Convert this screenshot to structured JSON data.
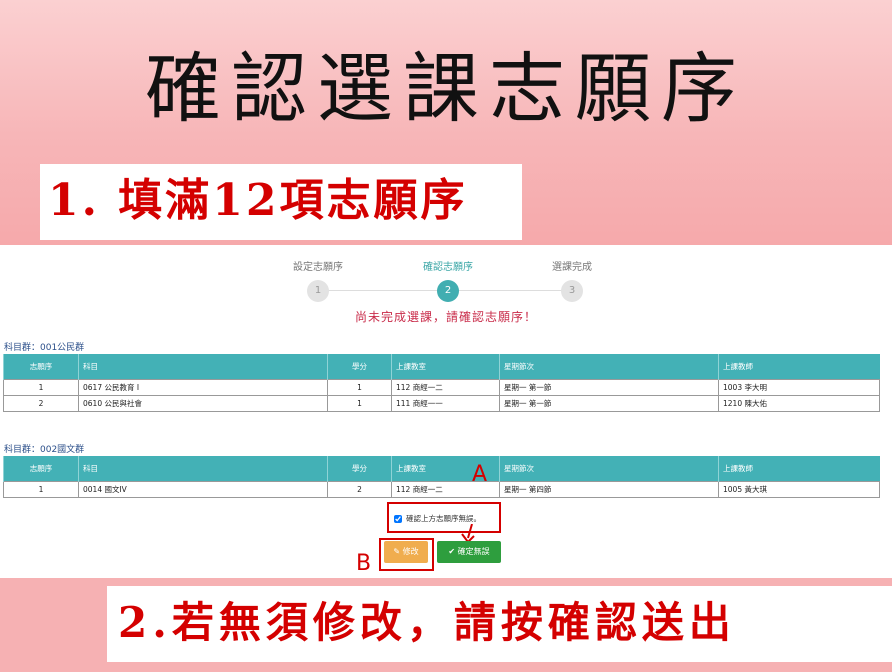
{
  "title": "確認選課志願序",
  "step1_instruction": "1. 填滿12項志願序",
  "step2_instruction": "2.若無須修改，請按確認送出",
  "stepper": {
    "steps": [
      {
        "label": "設定志願序",
        "number": "1",
        "active": false
      },
      {
        "label": "確認志願序",
        "number": "2",
        "active": true
      },
      {
        "label": "選課完成",
        "number": "3",
        "active": false
      }
    ]
  },
  "warning": "尚未完成選課，請確認志願序！",
  "headers": [
    "志願序",
    "科目",
    "學分",
    "上課教室",
    "星期節次",
    "上課教師"
  ],
  "groups": [
    {
      "label": "科目群：001公民群",
      "rows": [
        [
          "1",
          "0617 公民教育 I",
          "1",
          "112 商經一二",
          "星期一 第一節",
          "1003 李大明"
        ],
        [
          "2",
          "0610 公民與社會",
          "1",
          "111 商經一一",
          "星期一 第一節",
          "1210 陳大佑"
        ]
      ]
    },
    {
      "label": "科目群：002國文群",
      "rows": [
        [
          "1",
          "0014 國文IV",
          "2",
          "112 商經一二",
          "星期一 第四節",
          "1005 黃大琪"
        ]
      ]
    }
  ],
  "confirm_checkbox": "確認上方志願序無誤。",
  "buttons": {
    "edit": "修改",
    "confirm": "確定無誤"
  },
  "markers": {
    "a": "A",
    "b": "B"
  },
  "colors": {
    "accent": "#41aeb1",
    "warning": "#c92c4a",
    "annotation": "#d40000",
    "edit": "#f0ad4e",
    "confirm": "#2e9e3e"
  }
}
